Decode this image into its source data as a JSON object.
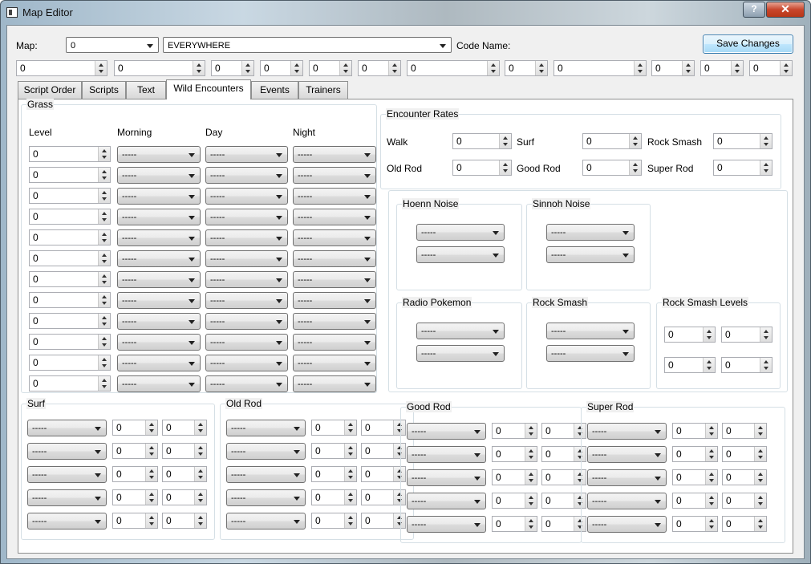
{
  "window": {
    "title": "Map Editor",
    "help_glyph": "?",
    "close_glyph": "✕"
  },
  "header": {
    "map_label": "Map:",
    "map_value": "0",
    "location_value": "EVERYWHERE",
    "code_name_label": "Code Name:",
    "save_label": "Save Changes",
    "header_values": [
      "0",
      "0",
      "0",
      "0",
      "0",
      "0",
      "0",
      "0",
      "0",
      "0",
      "0",
      "0"
    ]
  },
  "tabs": [
    "Script Order",
    "Scripts",
    "Text",
    "Wild Encounters",
    "Events",
    "Trainers"
  ],
  "active_tab": "Wild Encounters",
  "grass": {
    "title": "Grass",
    "col_level": "Level",
    "col_morning": "Morning",
    "col_day": "Day",
    "col_night": "Night",
    "rows": [
      {
        "level": "0",
        "morning": "-----",
        "day": "-----",
        "night": "-----"
      },
      {
        "level": "0",
        "morning": "-----",
        "day": "-----",
        "night": "-----"
      },
      {
        "level": "0",
        "morning": "-----",
        "day": "-----",
        "night": "-----"
      },
      {
        "level": "0",
        "morning": "-----",
        "day": "-----",
        "night": "-----"
      },
      {
        "level": "0",
        "morning": "-----",
        "day": "-----",
        "night": "-----"
      },
      {
        "level": "0",
        "morning": "-----",
        "day": "-----",
        "night": "-----"
      },
      {
        "level": "0",
        "morning": "-----",
        "day": "-----",
        "night": "-----"
      },
      {
        "level": "0",
        "morning": "-----",
        "day": "-----",
        "night": "-----"
      },
      {
        "level": "0",
        "morning": "-----",
        "day": "-----",
        "night": "-----"
      },
      {
        "level": "0",
        "morning": "-----",
        "day": "-----",
        "night": "-----"
      },
      {
        "level": "0",
        "morning": "-----",
        "day": "-----",
        "night": "-----"
      },
      {
        "level": "0",
        "morning": "-----",
        "day": "-----",
        "night": "-----"
      }
    ]
  },
  "encounter_rates": {
    "title": "Encounter Rates",
    "walk_label": "Walk",
    "walk": "0",
    "surf_label": "Surf",
    "surf": "0",
    "rock_smash_label": "Rock Smash",
    "rock_smash": "0",
    "old_rod_label": "Old Rod",
    "old_rod": "0",
    "good_rod_label": "Good Rod",
    "good_rod": "0",
    "super_rod_label": "Super Rod",
    "super_rod": "0"
  },
  "hoenn": {
    "title": "Hoenn Noise",
    "slots": [
      "-----",
      "-----"
    ]
  },
  "sinnoh": {
    "title": "Sinnoh Noise",
    "slots": [
      "-----",
      "-----"
    ]
  },
  "radio": {
    "title": "Radio Pokemon",
    "slots": [
      "-----",
      "-----"
    ]
  },
  "rock_smash": {
    "title": "Rock Smash",
    "slots": [
      "-----",
      "-----"
    ]
  },
  "rock_smash_levels": {
    "title": "Rock Smash Levels",
    "values": [
      "0",
      "0",
      "0",
      "0"
    ]
  },
  "surf": {
    "title": "Surf",
    "rows": [
      {
        "pokemon": "-----",
        "min": "0",
        "max": "0"
      },
      {
        "pokemon": "-----",
        "min": "0",
        "max": "0"
      },
      {
        "pokemon": "-----",
        "min": "0",
        "max": "0"
      },
      {
        "pokemon": "-----",
        "min": "0",
        "max": "0"
      },
      {
        "pokemon": "-----",
        "min": "0",
        "max": "0"
      }
    ]
  },
  "old_rod": {
    "title": "Old Rod",
    "rows": [
      {
        "pokemon": "-----",
        "min": "0",
        "max": "0"
      },
      {
        "pokemon": "-----",
        "min": "0",
        "max": "0"
      },
      {
        "pokemon": "-----",
        "min": "0",
        "max": "0"
      },
      {
        "pokemon": "-----",
        "min": "0",
        "max": "0"
      },
      {
        "pokemon": "-----",
        "min": "0",
        "max": "0"
      }
    ]
  },
  "good_rod": {
    "title": "Good Rod",
    "rows": [
      {
        "pokemon": "-----",
        "min": "0",
        "max": "0"
      },
      {
        "pokemon": "-----",
        "min": "0",
        "max": "0"
      },
      {
        "pokemon": "-----",
        "min": "0",
        "max": "0"
      },
      {
        "pokemon": "-----",
        "min": "0",
        "max": "0"
      },
      {
        "pokemon": "-----",
        "min": "0",
        "max": "0"
      }
    ]
  },
  "super_rod": {
    "title": "Super Rod",
    "rows": [
      {
        "pokemon": "-----",
        "min": "0",
        "max": "0"
      },
      {
        "pokemon": "-----",
        "min": "0",
        "max": "0"
      },
      {
        "pokemon": "-----",
        "min": "0",
        "max": "0"
      },
      {
        "pokemon": "-----",
        "min": "0",
        "max": "0"
      },
      {
        "pokemon": "-----",
        "min": "0",
        "max": "0"
      }
    ]
  }
}
